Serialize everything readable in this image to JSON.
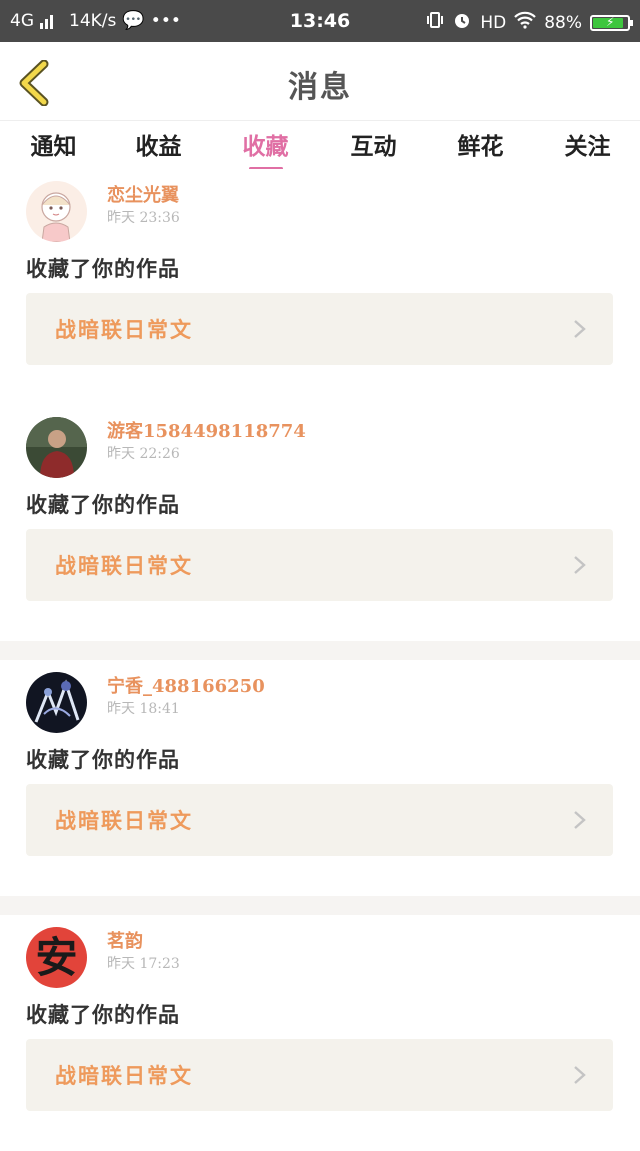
{
  "status_bar": {
    "network": "4G",
    "speed": "14K/s",
    "dots": "•••",
    "time": "13:46",
    "hd": "HD",
    "battery_pct": "88%",
    "battery_level": 0.88,
    "battery_color": "#3ec63e"
  },
  "header": {
    "title": "消息"
  },
  "tabs": [
    {
      "label": "通知",
      "active": false
    },
    {
      "label": "收益",
      "active": false
    },
    {
      "label": "收藏",
      "active": true
    },
    {
      "label": "互动",
      "active": false
    },
    {
      "label": "鲜花",
      "active": false
    },
    {
      "label": "关注",
      "active": false
    }
  ],
  "accent_color": "#e06fa4",
  "username_color": "#e8925e",
  "messages": [
    {
      "username": "恋尘光翼",
      "time": "昨天 23:36",
      "action": "收藏了你的作品",
      "work_title": "战暗联日常文",
      "avatar_icon": "anime-girl-avatar"
    },
    {
      "username": "游客1584498118774",
      "time": "昨天 22:26",
      "action": "收藏了你的作品",
      "work_title": "战暗联日常文",
      "avatar_icon": "man-photo-avatar"
    },
    {
      "username": "宁香_488166250",
      "time": "昨天 18:41",
      "action": "收藏了你的作品",
      "work_title": "战暗联日常文",
      "avatar_icon": "dark-art-avatar"
    },
    {
      "username": "茗韵",
      "time": "昨天 17:23",
      "action": "收藏了你的作品",
      "work_title": "战暗联日常文",
      "avatar_icon": "red-character-avatar",
      "avatar_text": "安"
    }
  ]
}
